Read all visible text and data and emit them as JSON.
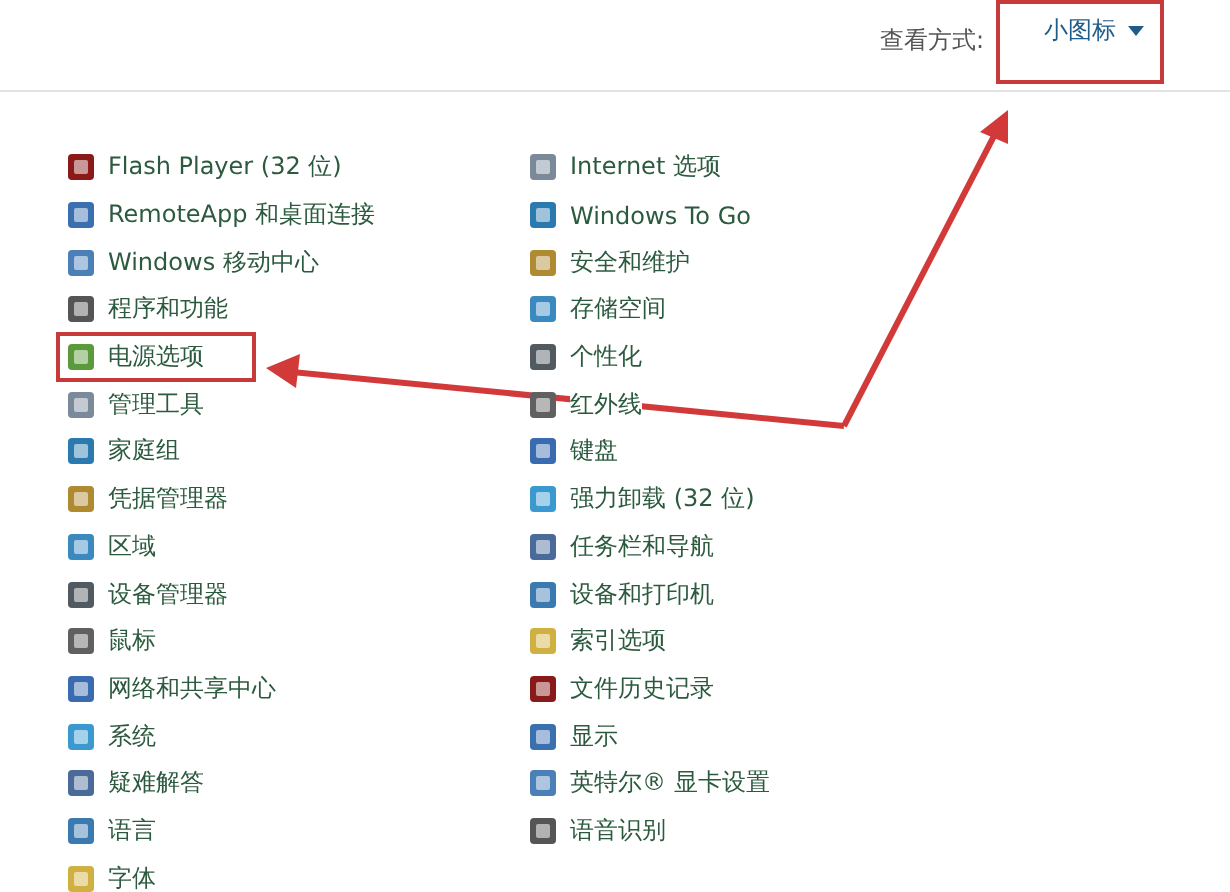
{
  "header": {
    "view_label": "查看方式:",
    "view_value": "小图标",
    "view_highlighted": true
  },
  "columns": [
    {
      "items": [
        {
          "label": "Flash Player (32 位)",
          "highlighted": false
        },
        {
          "label": "RemoteApp 和桌面连接",
          "highlighted": false
        },
        {
          "label": "Windows 移动中心",
          "highlighted": false
        },
        {
          "label": "程序和功能",
          "highlighted": false
        },
        {
          "label": "电源选项",
          "highlighted": true
        },
        {
          "label": "管理工具",
          "highlighted": false
        },
        {
          "label": "家庭组",
          "highlighted": false
        },
        {
          "label": "凭据管理器",
          "highlighted": false
        },
        {
          "label": "区域",
          "highlighted": false
        },
        {
          "label": "设备管理器",
          "highlighted": false
        },
        {
          "label": "鼠标",
          "highlighted": false
        },
        {
          "label": "网络和共享中心",
          "highlighted": false
        },
        {
          "label": "系统",
          "highlighted": false
        },
        {
          "label": "疑难解答",
          "highlighted": false
        },
        {
          "label": "语言",
          "highlighted": false
        },
        {
          "label": "字体",
          "highlighted": false
        }
      ]
    },
    {
      "items": [
        {
          "label": "Internet 选项",
          "highlighted": false
        },
        {
          "label": "Windows To Go",
          "highlighted": false
        },
        {
          "label": "安全和维护",
          "highlighted": false
        },
        {
          "label": "存储空间",
          "highlighted": false
        },
        {
          "label": "个性化",
          "highlighted": false
        },
        {
          "label": "红外线",
          "highlighted": false
        },
        {
          "label": "键盘",
          "highlighted": false
        },
        {
          "label": "强力卸载 (32 位)",
          "highlighted": false
        },
        {
          "label": "任务栏和导航",
          "highlighted": false
        },
        {
          "label": "设备和打印机",
          "highlighted": false
        },
        {
          "label": "索引选项",
          "highlighted": false
        },
        {
          "label": "文件历史记录",
          "highlighted": false
        },
        {
          "label": "显示",
          "highlighted": false
        },
        {
          "label": "英特尔® 显卡设置",
          "highlighted": false
        },
        {
          "label": "语音识别",
          "highlighted": false
        }
      ]
    }
  ]
}
